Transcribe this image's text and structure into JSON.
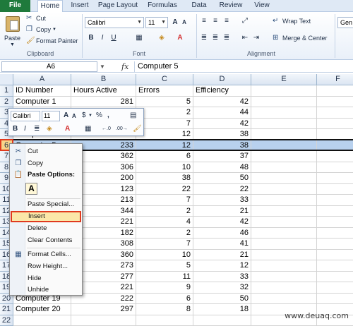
{
  "tabs": [
    "File",
    "Home",
    "Insert",
    "Page Layout",
    "Formulas",
    "Data",
    "Review",
    "View"
  ],
  "ribbon": {
    "clipboard_label": "Clipboard",
    "font_label": "Font",
    "alignment_label": "Alignment",
    "paste": "Paste",
    "cut": "Cut",
    "copy": "Copy",
    "format_painter": "Format Painter",
    "font_name": "Calibri",
    "font_size": "11",
    "wrap_text": "Wrap Text",
    "merge_center": "Merge & Center",
    "general_partial": "Gen"
  },
  "formula_bar": {
    "name_box": "A6",
    "fx": "fx",
    "formula": "Computer 5"
  },
  "columns": [
    "A",
    "B",
    "C",
    "D",
    "E",
    "F"
  ],
  "rows": [
    {
      "n": "1",
      "a": "ID Number",
      "b": "Hours Active",
      "c": "Errors",
      "d": "Efficiency"
    },
    {
      "n": "2",
      "a": "Computer 1",
      "b": "281",
      "c": "5",
      "d": "42"
    },
    {
      "n": "3",
      "a": "",
      "b": "",
      "c": "2",
      "d": "44"
    },
    {
      "n": "4",
      "a": "",
      "b": "",
      "c": "7",
      "d": "42"
    },
    {
      "n": "5",
      "a": "Computer 4",
      "b": "",
      "c": "12",
      "d": "38"
    },
    {
      "n": "6",
      "a": "Computer 5",
      "b": "233",
      "c": "12",
      "d": "38"
    },
    {
      "n": "7",
      "a": "",
      "b": "362",
      "c": "6",
      "d": "37"
    },
    {
      "n": "8",
      "a": "",
      "b": "306",
      "c": "10",
      "d": "48"
    },
    {
      "n": "9",
      "a": "",
      "b": "200",
      "c": "38",
      "d": "50"
    },
    {
      "n": "10",
      "a": "",
      "b": "123",
      "c": "22",
      "d": "22"
    },
    {
      "n": "11",
      "a": "",
      "b": "213",
      "c": "7",
      "d": "33"
    },
    {
      "n": "12",
      "a": "",
      "b": "344",
      "c": "2",
      "d": "21"
    },
    {
      "n": "13",
      "a": "",
      "b": "221",
      "c": "4",
      "d": "42"
    },
    {
      "n": "14",
      "a": "",
      "b": "182",
      "c": "2",
      "d": "46"
    },
    {
      "n": "15",
      "a": "",
      "b": "308",
      "c": "7",
      "d": "41"
    },
    {
      "n": "16",
      "a": "",
      "b": "360",
      "c": "10",
      "d": "21"
    },
    {
      "n": "17",
      "a": "",
      "b": "273",
      "c": "5",
      "d": "12"
    },
    {
      "n": "18",
      "a": "",
      "b": "277",
      "c": "11",
      "d": "33"
    },
    {
      "n": "19",
      "a": "",
      "b": "221",
      "c": "9",
      "d": "32"
    },
    {
      "n": "20",
      "a": "Computer 19",
      "b": "222",
      "c": "6",
      "d": "50"
    },
    {
      "n": "21",
      "a": "Computer 20",
      "b": "297",
      "c": "8",
      "d": "18"
    },
    {
      "n": "22",
      "a": "",
      "b": "",
      "c": "",
      "d": ""
    }
  ],
  "mini_toolbar": {
    "font": "Calibri",
    "size": "11",
    "bold": "B",
    "italic": "I",
    "currency": "$",
    "percent": "%",
    "comma": ","
  },
  "context_menu": {
    "cut": "Cut",
    "copy": "Copy",
    "paste_options": "Paste Options:",
    "paste_icon": "A",
    "paste_special": "Paste Special...",
    "insert": "Insert",
    "delete": "Delete",
    "clear_contents": "Clear Contents",
    "format_cells": "Format Cells...",
    "row_height": "Row Height...",
    "hide": "Hide",
    "unhide": "Unhide"
  },
  "watermark": "www.deuaq.com",
  "colors": {
    "file_tab": "#1f7a3c",
    "selection": "#b8d1ee",
    "highlight": "#e03a1e"
  }
}
